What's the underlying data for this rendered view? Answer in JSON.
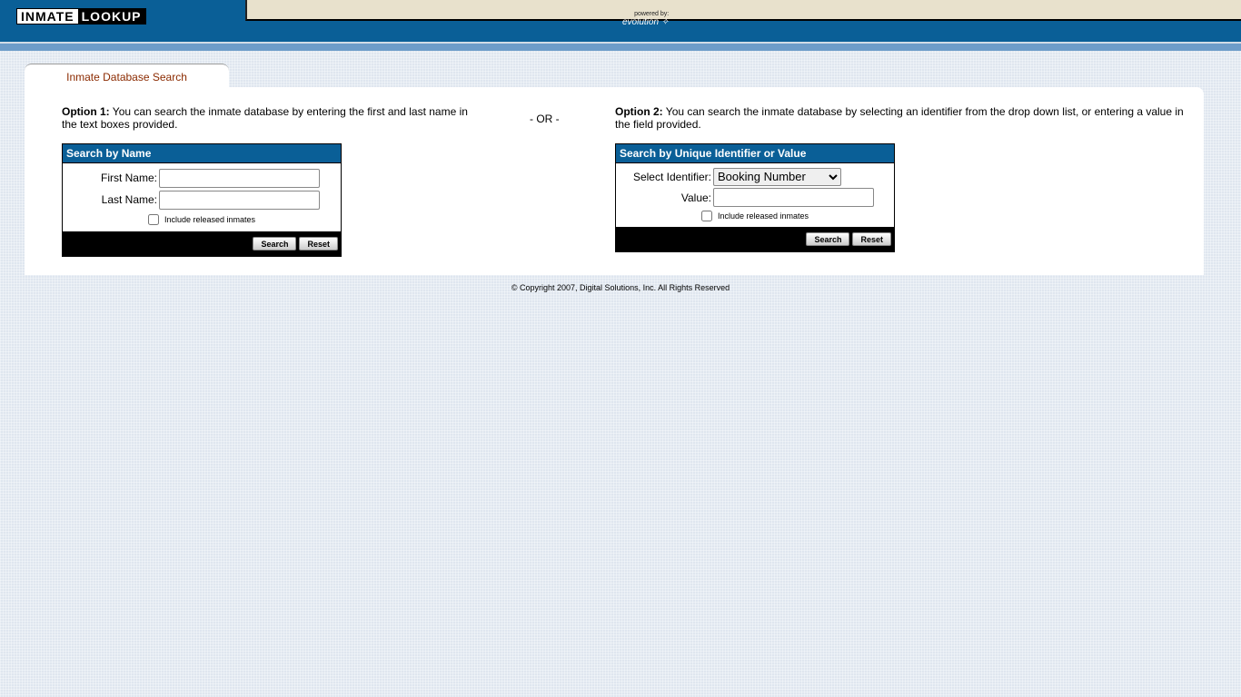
{
  "header": {
    "logo_word1": "INMATE",
    "logo_word2": "LOOKUP",
    "powered_by": "powered by:",
    "brand": "evolution"
  },
  "tab": {
    "label": "Inmate Database Search"
  },
  "option1": {
    "label": "Option 1:",
    "text": " You can search the inmate database by entering the first and last name in the text boxes provided."
  },
  "separator": "- OR -",
  "option2": {
    "label": "Option 2:",
    "text": " You can search the inmate database by selecting an identifier from the drop down list, or entering a value in the field provided."
  },
  "name_search": {
    "title": "Search by Name",
    "first_label": "First Name:",
    "first_value": "",
    "last_label": "Last Name:",
    "last_value": "",
    "include_released": "Include released inmates",
    "search": "Search",
    "reset": "Reset"
  },
  "id_search": {
    "title": "Search by Unique Identifier or Value",
    "identifier_label": "Select Identifier:",
    "identifier_selected": "Booking Number",
    "value_label": "Value:",
    "value": "",
    "include_released": "Include released inmates",
    "search": "Search",
    "reset": "Reset"
  },
  "footer": {
    "copyright": "© Copyright 2007, Digital Solutions, Inc. All Rights Reserved"
  }
}
